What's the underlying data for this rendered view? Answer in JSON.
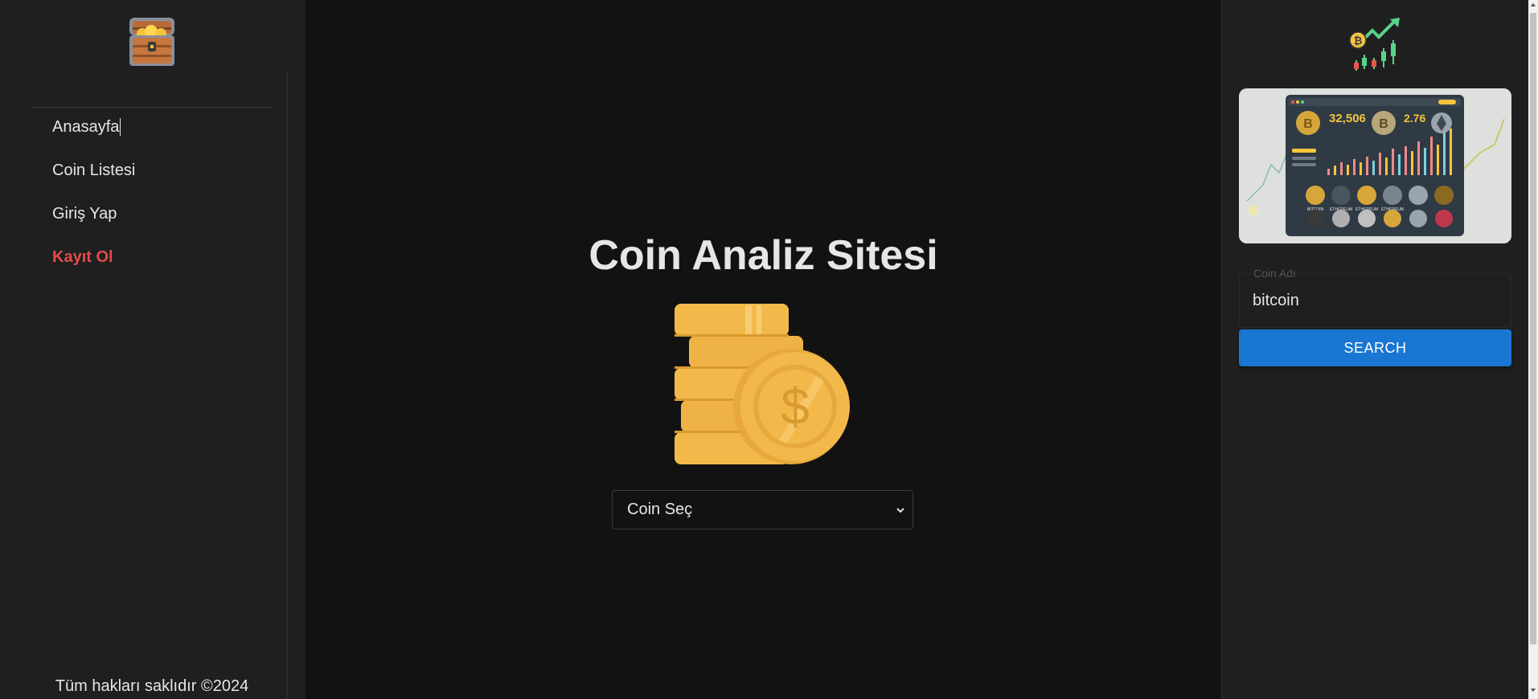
{
  "sidebar": {
    "logo_icon": "treasure-chest-icon",
    "items": [
      {
        "label": "Anasayfa"
      },
      {
        "label": "Coin Listesi"
      },
      {
        "label": "Giriş Yap"
      },
      {
        "label": "Kayıt Ol"
      }
    ],
    "footer": "Tüm hakları saklıdır ©2024"
  },
  "main": {
    "title": "Coin Analiz Sitesi",
    "illustration_icon": "coin-stack-dollar-icon",
    "coin_select": {
      "selected": "Coin Seç"
    }
  },
  "right_panel": {
    "logo_icon": "crypto-chart-icon",
    "banner": {
      "big_number": "32,506",
      "small_number": "2.76",
      "labels": [
        "BITCOIN",
        "ETHEREUM",
        "ETHEREUM",
        "ETHEREUM"
      ]
    },
    "search": {
      "label": "Coin Adı",
      "value": "bitcoin",
      "button_label": "SEARCH"
    }
  },
  "colors": {
    "accent": "#1976d2",
    "register": "#e24b4b",
    "coin_gold": "#f2b94a",
    "background": "#121212",
    "panel": "#1f1f1f"
  }
}
